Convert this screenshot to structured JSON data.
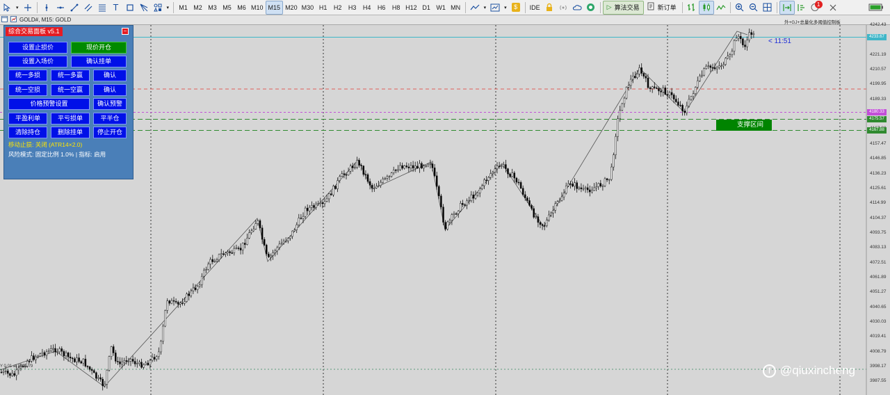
{
  "toolbar": {
    "timeframes": [
      "M1",
      "M2",
      "M3",
      "M5",
      "M6",
      "M10",
      "M15",
      "M20",
      "M30",
      "H1",
      "H2",
      "H3",
      "H4",
      "H6",
      "H8",
      "H12",
      "D1",
      "W1",
      "MN"
    ],
    "active_timeframe": "M15",
    "ide_label": "IDE",
    "algo_trading_label": "算法交易",
    "new_order_label": "新订单",
    "notification_count": "1"
  },
  "tab": {
    "title": "GOLD#, M15:  GOLD"
  },
  "chart": {
    "symbol": "GOLD#",
    "timeframe": "M15",
    "countdown": "< 11:51",
    "top_note": "外+GJ+总量化多阈值控制板",
    "lower_left_note": "Y 0.01 at 3992.79",
    "support_label": "支撑区间",
    "price_axis": [
      "4242.43",
      "4231.81",
      "4221.19",
      "4210.57",
      "4199.95",
      "4189.33",
      "4178.71",
      "4167.88",
      "4157.47",
      "4146.85",
      "4136.23",
      "4125.61",
      "4114.99",
      "4104.37",
      "4093.75",
      "4083.13",
      "4072.51",
      "4061.89",
      "4051.27",
      "4040.65",
      "4030.03",
      "4019.41",
      "4008.79",
      "3998.17",
      "3987.55"
    ],
    "price_tags": {
      "current": "4233.67",
      "magenta": "4180.33",
      "green_upper": "4175.57",
      "green_lower": "4167.88"
    },
    "colors": {
      "bull_candle": "#000000",
      "bear_candle": "#000000",
      "current_line": "#3fb6c8",
      "red_dash": "#e0605a",
      "magenta_dash": "#c24fd8",
      "green_dash": "#2f8a2f",
      "support_box": "#008400"
    }
  },
  "panel": {
    "title": "综合交易面板 v5.1",
    "close_label": "−",
    "buttons": {
      "set_stop": "设置止损价",
      "market_open": "现价开仓",
      "set_entry": "设置入场价",
      "confirm_pending": "确认挂单",
      "unify_long_sl": "统一多损",
      "unify_long_tp": "统一多赢",
      "confirm_1": "确认",
      "unify_short_sl": "统一空损",
      "unify_short_tp": "统一空赢",
      "confirm_2": "确认",
      "price_alert_set": "价格预警设置",
      "confirm_alert": "确认预警",
      "close_profit": "平盈利单",
      "close_loss": "平亏损单",
      "close_half": "平半仓",
      "clear_positions": "清除持仓",
      "delete_pending": "删除挂单",
      "stop_open": "停止开仓"
    },
    "trailing_stop": "移动止损: 关闭 (ATR14×2.0)",
    "risk_mode": "风险模式: 固定比例 1.0% | 指标: 启用"
  },
  "watermark": {
    "text": "@qiuxincheng"
  }
}
